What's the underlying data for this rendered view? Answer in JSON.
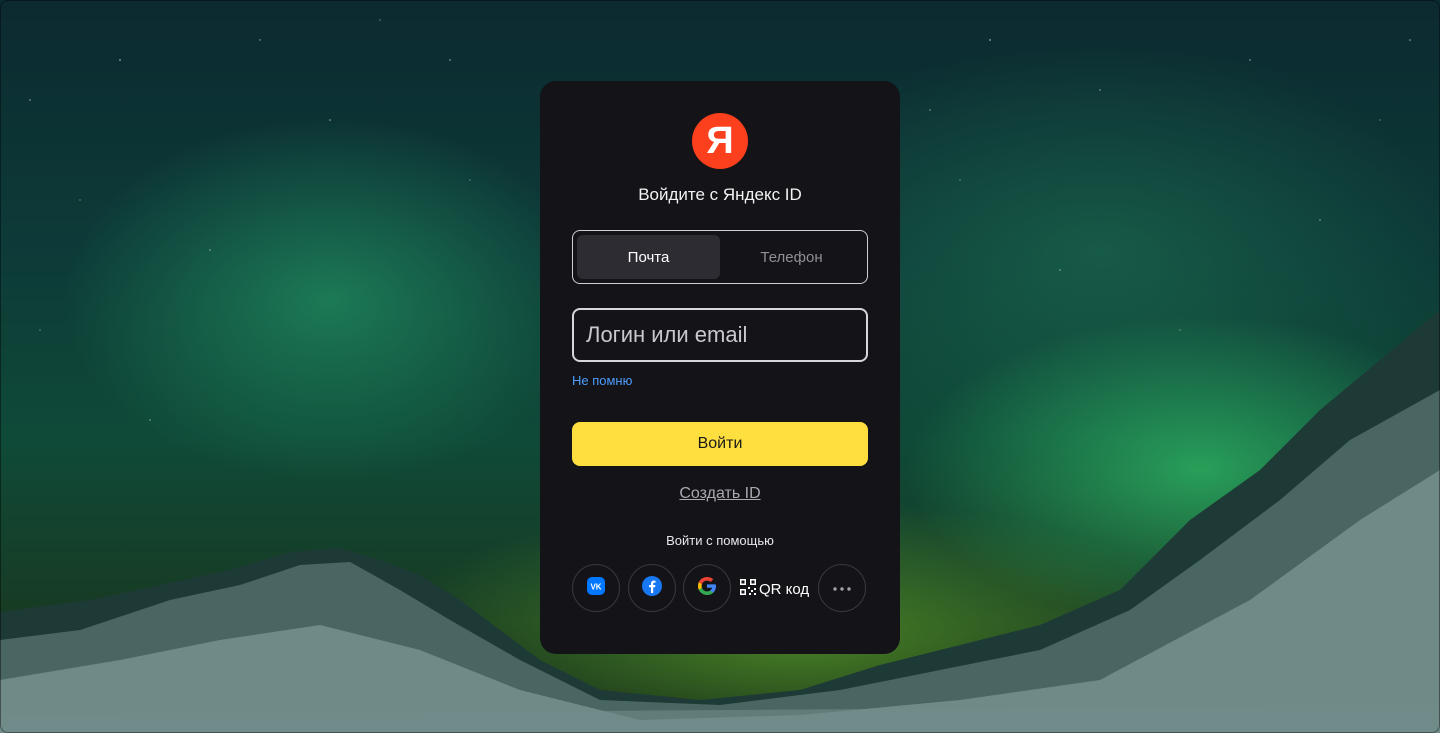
{
  "logo": {
    "letter": "Я",
    "color": "#fc3f1d"
  },
  "title": "Войдите с Яндекс ID",
  "tabs": [
    {
      "label": "Почта",
      "active": true
    },
    {
      "label": "Телефон",
      "active": false
    }
  ],
  "login": {
    "placeholder": "Логин или email",
    "value": ""
  },
  "forgot_link": "Не помню",
  "submit_label": "Войти",
  "create_link": "Создать ID",
  "social_heading": "Войти с помощью",
  "socials": [
    {
      "name": "vk",
      "icon": "vk-icon"
    },
    {
      "name": "facebook",
      "icon": "facebook-icon"
    },
    {
      "name": "google",
      "icon": "google-icon"
    },
    {
      "name": "qr",
      "icon": "qr-code-icon",
      "label": "QR код"
    },
    {
      "name": "more",
      "icon": "more-dots-icon"
    }
  ],
  "colors": {
    "accent_button": "#ffdf3f",
    "link": "#4d9cff",
    "card": "#141317"
  }
}
